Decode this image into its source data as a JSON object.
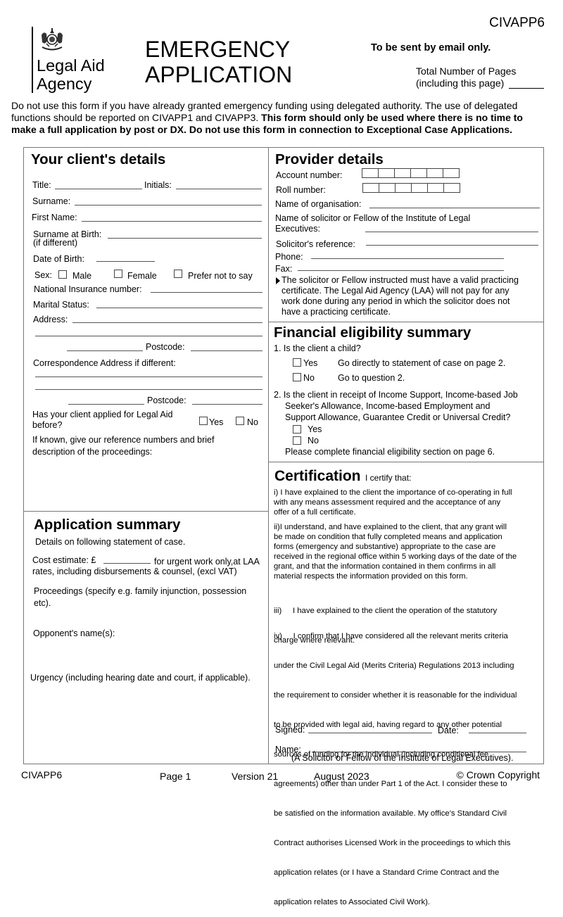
{
  "form_code_top": "CIVAPP6",
  "logo": {
    "icon": "royal-coat-of-arms-icon",
    "line1": "Legal Aid",
    "line2": "Agency"
  },
  "title": {
    "line1": "EMERGENCY",
    "line2": "APPLICATION"
  },
  "email_notice": "To be sent by email only.",
  "total_pages": {
    "line1": "Total Number of Pages",
    "line2": "(including this page)",
    "value": ""
  },
  "intro": {
    "normal": "Do not use this form if you have already granted emergency funding using delegated authority.  The use of delegated functions should be reported on CIVAPP1 and CIVAPP3.  ",
    "bold": "This form should only be used where there is no time to make a full application by post or DX.  Do not use this form in connection to Exceptional Case Applications."
  },
  "client": {
    "heading": "Your client's details",
    "title_label": "Title:",
    "initials_label": "Initials:",
    "surname_label": "Surname:",
    "first_name_label": "First Name:",
    "surname_birth_label": "Surname at Birth:",
    "surname_birth_note": "(if different)",
    "dob_label": "Date of Birth:",
    "sex_label": "Sex:",
    "sex_options": [
      "Male",
      "Female",
      "Prefer not to say"
    ],
    "ni_label": "National Insurance number:",
    "marital_label": "Marital Status:",
    "address_label": "Address:",
    "postcode_label": "Postcode:",
    "corr_address_label": "Correspondence Address if different:",
    "corr_postcode_label": "Postcode:",
    "applied_before_line1": "Has your client applied for Legal Aid",
    "applied_before_line2": "before?",
    "yes": "Yes",
    "no": "No",
    "reference_line1": "If known, give our reference numbers and brief",
    "reference_line2": "description of the proceedings:"
  },
  "app_summary": {
    "heading": "Application summary",
    "details_note": "Details on following statement of case.",
    "cost_label": "Cost estimate: £",
    "cost_suffix": "for urgent work only,at LAA",
    "cost_line2": "rates, including disbursements & counsel, (excl VAT)",
    "proceedings_line1": "Proceedings (specify e.g. family injunction, possession",
    "proceedings_line2": "etc).",
    "opponent_label": "Opponent's name(s):",
    "urgency_label": "Urgency (including hearing date and court, if applicable)."
  },
  "provider": {
    "heading": "Provider details",
    "account_label": "Account number:",
    "roll_label": "Roll number:",
    "org_label": "Name of organisation:",
    "solicitor_line1": "Name of solicitor or Fellow of the Institute of Legal",
    "solicitor_line2": "Executives:",
    "reference_label": "Solicitor's reference:",
    "phone_label": "Phone:",
    "fax_label": "Fax:",
    "note_lines": [
      "The solicitor or Fellow instructed must have a valid practicing",
      "certificate. The Legal Aid Agency (LAA) will not pay for any",
      "work done during any period in which the solicitor does not",
      "have a practicing certificate."
    ]
  },
  "financial": {
    "heading": "Financial eligibility summary",
    "q1": "1. Is the client a child?",
    "q1_yes": "Yes",
    "q1_yes_note": "Go directly to statement of case on page 2.",
    "q1_no": "No",
    "q1_no_note": "Go to question 2.",
    "q2_lines": [
      "2. Is the client in receipt of Income Support, Income-based Job",
      "Seeker's Allowance, Income-based Employment and",
      "Support Allowance, Guarantee Credit or Universal Credit?"
    ],
    "q2_yes": "Yes",
    "q2_no": "No",
    "q2_note": "Please complete financial eligibility section on page 6."
  },
  "certification": {
    "heading": "Certification",
    "subheading": "I certify that:",
    "i_lines": [
      "i) I have explained to the client the importance of co-operating in full",
      "with any means assessment required and the acceptance of any",
      "offer of a full certificate."
    ],
    "ii_lines": [
      "ii)I understand, and have explained to the client, that any grant will",
      "be made on condition that fully completed means and application",
      "forms (emergency and substantive) appropriate to the case are",
      "received in the regional office within 5 working days of the date of the",
      "grant, and that the information contained in them confirms in all",
      "material respects the information provided on this form."
    ],
    "iii_lines": [
      "iii)     I have explained to the client the operation of the statutory",
      "charge where relevant."
    ],
    "iv_lines": [
      "iv)     I confirm that I have considered all the relevant merits criteria",
      "under the Civil Legal Aid (Merits Criteria) Regulations 2013 including",
      "the requirement to consider whether it is reasonable for the individual",
      "to be provided with legal aid, having regard to any other potential",
      "sources of funding for the individual (including conditional fee",
      "agreements) other than under Part 1 of the Act. I consider these to",
      "be satisfied on the information available. My office's Standard Civil",
      "Contract authorises Licensed Work in the proceedings to which this",
      "application relates (or I have a Standard Crime Contract and the",
      "application relates to Associated Civil Work)."
    ],
    "signed_label": "Signed:",
    "date_label": "Date:",
    "name_label": "Name:",
    "name_note": "(A Solicitor or Fellow of the Institute of Legal Executives)."
  },
  "footer": {
    "code": "CIVAPP6",
    "page": "Page 1",
    "version": "Version 21",
    "date": "August 2023",
    "copyright": "© Crown Copyright"
  }
}
